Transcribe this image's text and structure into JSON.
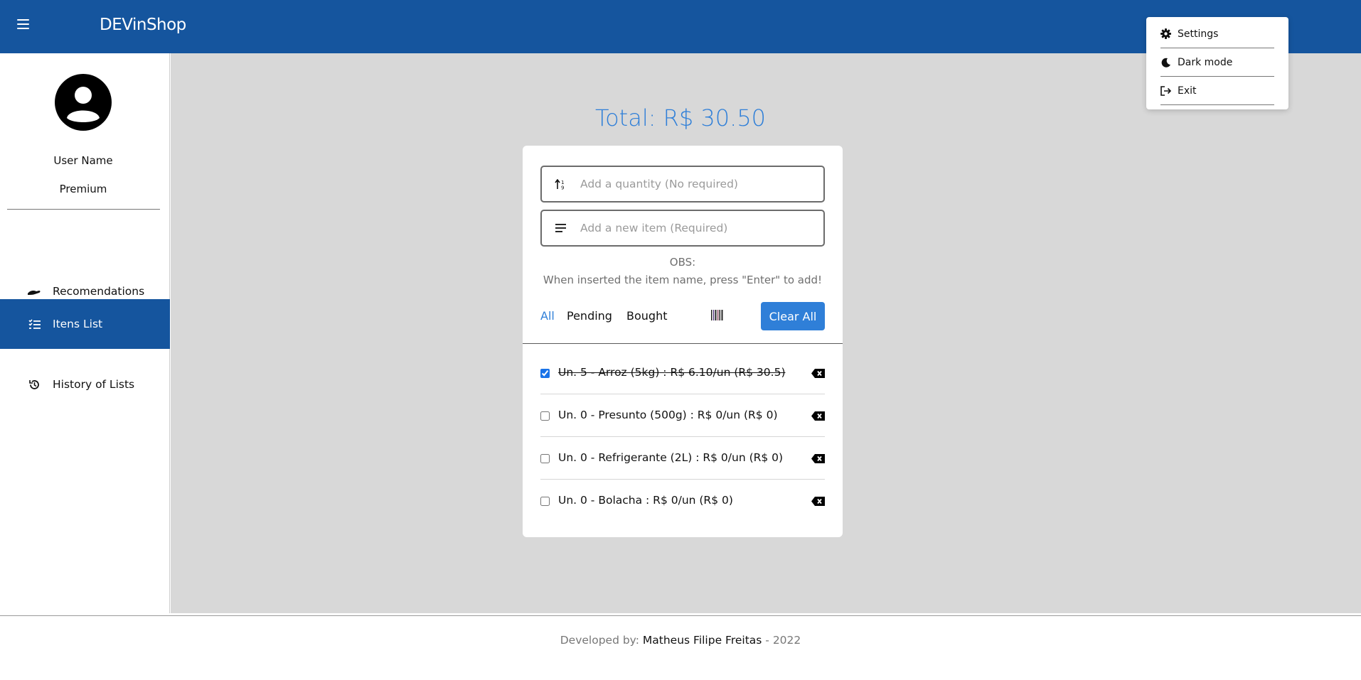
{
  "header": {
    "brand": "DEVinShop",
    "menu_icon": "hamburger-icon"
  },
  "sidebar": {
    "user_name": "User Name",
    "user_plan": "Premium",
    "items": [
      {
        "label": "Recomendations",
        "icon": "hand-icon",
        "active": false
      },
      {
        "label": "Itens List",
        "icon": "checklist-icon",
        "active": true
      },
      {
        "label": "History of Lists",
        "icon": "history-icon",
        "active": false
      }
    ]
  },
  "main": {
    "total": "Total: R$ 30.50",
    "quantity_placeholder": "Add a quantity (No required)",
    "item_placeholder": "Add a new item (Required)",
    "obs_title": "OBS:",
    "obs_text": "When inserted the item name, press \"Enter\" to add!",
    "filters": [
      "All",
      "Pending",
      "Bought"
    ],
    "active_filter": "All",
    "clear_label": "Clear All",
    "items": [
      {
        "text": "Un. 5 - Arroz (5kg) : R$ 6.10/un (R$ 30.5)",
        "checked": true
      },
      {
        "text": "Un. 0 - Presunto (500g) : R$ 0/un (R$ 0)",
        "checked": false
      },
      {
        "text": "Un. 0 - Refrigerante (2L) : R$ 0/un (R$ 0)",
        "checked": false
      },
      {
        "text": "Un. 0 - Bolacha : R$ 0/un (R$ 0)",
        "checked": false
      }
    ]
  },
  "dropdown_menu": {
    "items": [
      {
        "label": "Settings",
        "icon": "gear-icon"
      },
      {
        "label": "Dark mode",
        "icon": "moon-icon"
      },
      {
        "label": "Exit",
        "icon": "exit-icon"
      }
    ]
  },
  "footer": {
    "prefix": "Developed by:",
    "author": "Matheus Filipe Freitas",
    "suffix": "- 2022"
  },
  "colors": {
    "header": "#15559e",
    "accent": "#2f7fd8",
    "background": "#d8d8d8"
  }
}
